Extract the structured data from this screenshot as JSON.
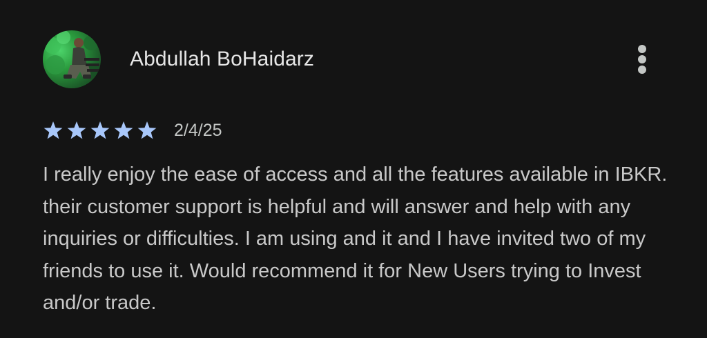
{
  "review": {
    "author": "Abdullah BoHaidarz",
    "avatar_icon": "user-photo",
    "rating": 5,
    "max_rating": 5,
    "star_color": "#a8c7fa",
    "date": "2/4/25",
    "text": "I really enjoy the ease of access and all the features available in IBKR. their customer support is helpful and will answer and help with any inquiries or difficulties. I am using and it and I have invited two of my friends to use it. Would recommend it for New Users trying to Invest and/or trade.",
    "menu_icon": "more-vert-icon"
  }
}
